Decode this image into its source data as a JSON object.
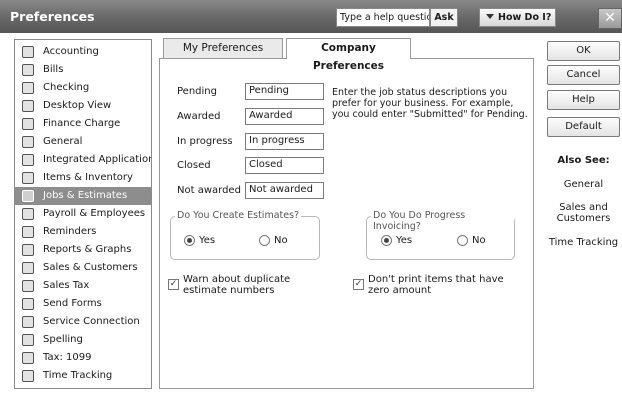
{
  "window": {
    "title": "Preferences",
    "help_placeholder": "Type a help question",
    "ask_label": "Ask",
    "how_do_i_label": "How Do I?",
    "close_glyph": "✕"
  },
  "sidebar": {
    "items": [
      {
        "label": "Accounting",
        "icon": "accounting-icon"
      },
      {
        "label": "Bills",
        "icon": "bills-icon"
      },
      {
        "label": "Checking",
        "icon": "checking-icon"
      },
      {
        "label": "Desktop View",
        "icon": "desktop-view-icon"
      },
      {
        "label": "Finance Charge",
        "icon": "finance-charge-icon"
      },
      {
        "label": "General",
        "icon": "general-icon"
      },
      {
        "label": "Integrated Applications",
        "icon": "integrated-applications-icon"
      },
      {
        "label": "Items & Inventory",
        "icon": "items-inventory-icon"
      },
      {
        "label": "Jobs & Estimates",
        "icon": "jobs-estimates-icon",
        "selected": true
      },
      {
        "label": "Payroll & Employees",
        "icon": "payroll-icon"
      },
      {
        "label": "Reminders",
        "icon": "reminders-icon"
      },
      {
        "label": "Reports & Graphs",
        "icon": "reports-graphs-icon"
      },
      {
        "label": "Sales & Customers",
        "icon": "sales-customers-icon"
      },
      {
        "label": "Sales Tax",
        "icon": "sales-tax-icon"
      },
      {
        "label": "Send Forms",
        "icon": "send-forms-icon"
      },
      {
        "label": "Service Connection",
        "icon": "service-connection-icon"
      },
      {
        "label": "Spelling",
        "icon": "spelling-icon"
      },
      {
        "label": "Tax: 1099",
        "icon": "tax-1099-icon"
      },
      {
        "label": "Time Tracking",
        "icon": "time-tracking-icon"
      }
    ]
  },
  "tabs": {
    "my_preferences": "My Preferences",
    "company_preferences": "Company Preferences"
  },
  "job_status": {
    "pending": {
      "label": "Pending",
      "value": "Pending"
    },
    "awarded": {
      "label": "Awarded",
      "value": "Awarded"
    },
    "in_progress": {
      "label": "In progress",
      "value": "In progress"
    },
    "closed": {
      "label": "Closed",
      "value": "Closed"
    },
    "not_awarded": {
      "label": "Not awarded",
      "value": "Not awarded"
    },
    "description": "Enter the job status descriptions you prefer for your business.  For example, you could enter \"Submitted\" for Pending."
  },
  "estimates": {
    "title": "Do You Create Estimates?",
    "yes": "Yes",
    "no": "No",
    "selected": "Yes"
  },
  "progress_invoicing": {
    "title": "Do You Do Progress Invoicing?",
    "yes": "Yes",
    "no": "No",
    "selected": "Yes"
  },
  "checkboxes": {
    "warn_duplicate": {
      "label": "Warn about duplicate estimate numbers",
      "checked": true
    },
    "dont_print_zero": {
      "label": "Don't print items that have zero amount",
      "checked": true
    }
  },
  "buttons": {
    "ok": "OK",
    "cancel": "Cancel",
    "help": "Help",
    "default": "Default"
  },
  "also_see": {
    "title": "Also See:",
    "links": [
      "General",
      "Sales and Customers",
      "Time Tracking"
    ]
  }
}
